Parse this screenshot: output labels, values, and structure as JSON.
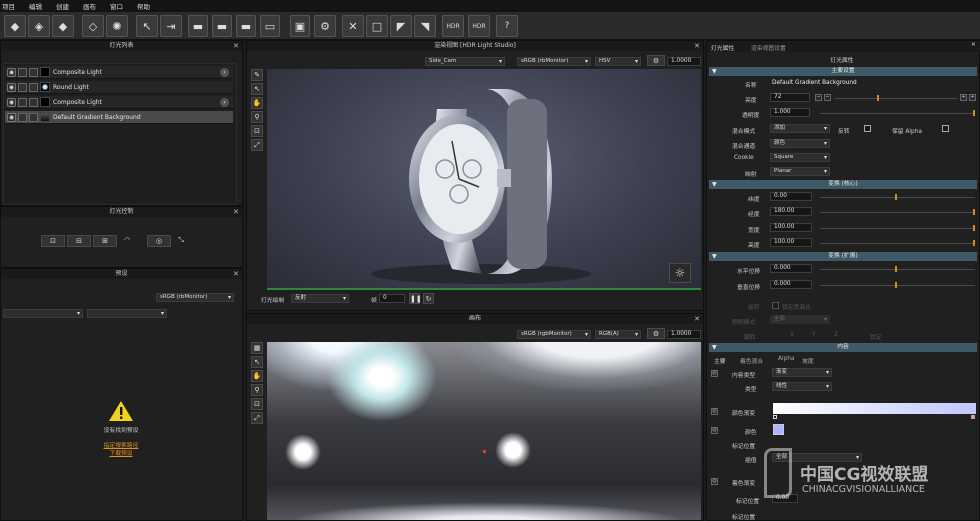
{
  "menu": [
    "项目",
    "编辑",
    "创建",
    "画布",
    "窗口",
    "帮助"
  ],
  "toolbar": {
    "hdr1": "HDR",
    "hdr2": "HDR",
    "help": "?"
  },
  "light_list": {
    "title": "灯光列表",
    "rows": [
      {
        "name": "Composite Light",
        "selected": false
      },
      {
        "name": "Round Light",
        "selected": false
      },
      {
        "name": "Composite Light",
        "selected": false
      },
      {
        "name": "Default Gradient Background",
        "selected": true
      }
    ]
  },
  "light_control": {
    "title": "灯光控制"
  },
  "presets": {
    "title": "预设",
    "color_space": "sRGB (rbMonitor)",
    "warning": "没有找到预设",
    "link1": "指定搜索路径",
    "link2": "下载预设"
  },
  "render_view": {
    "title": "渲染视图 [HDR Light Studio]",
    "camera": "Side_Cam",
    "color_space": "sRGB (rbMonitor)",
    "mode": "HSV",
    "value": "1.0000",
    "paint_label": "灯光绘制",
    "paint_mode": "反射",
    "frame_label": "帧",
    "frame_value": "0"
  },
  "canvas": {
    "title": "画布",
    "color_space": "sRGB (rgbMonitor)",
    "mode": "RGB(A)",
    "value": "1.0000"
  },
  "props": {
    "tab1": "灯光属性",
    "tab2": "渲染视图设置",
    "title": "灯光属性",
    "sec_main": "主要设置",
    "name_label": "名称",
    "name_value": "Default Gradient Background",
    "brightness_label": "亮度",
    "brightness_value": "72",
    "opacity_label": "透明度",
    "opacity_value": "1.000",
    "blend_label": "混合模式",
    "blend_value": "添加",
    "invert_label": "反转",
    "keep_alpha_label": "保留 Alpha",
    "blend_channel_label": "混合通道",
    "blend_channel_value": "颜色",
    "cookie_label": "Cookie",
    "cookie_value": "Square",
    "mapping_label": "映射",
    "mapping_value": "Planar",
    "sec_transform": "变换 (核心)",
    "lat_label": "纬度",
    "lat_value": "0.00",
    "lon_label": "经度",
    "lon_value": "180.00",
    "width_label": "宽度",
    "width_value": "100.00",
    "height_label": "高度",
    "height_value": "100.00",
    "sec_transform_ext": "变换 (扩展)",
    "hoff_label": "水平位移",
    "hoff_value": "0.000",
    "voff_label": "垂直位移",
    "voff_value": "0.000",
    "rotate_label": "旋转",
    "lock_aspect_label": "锁定宽高比",
    "light_mode_label": "照明模式",
    "light_mode_value": "全部",
    "flip_label": "翻转",
    "flip_x": "X",
    "flip_y": "Y",
    "flip_z": "Z",
    "lock_label": "锁定",
    "sec_content": "内容",
    "ctab_main": "主要",
    "ctab_blend": "着色混合",
    "ctab_alpha": "Alpha",
    "ctab_ramp": "坡度",
    "content_type_label": "内容类型",
    "content_type_value": "渐变",
    "type_label": "类型",
    "type_value": "线性",
    "gradient_label": "颜色渐变",
    "color_label": "颜色",
    "marker_label": "标记位置",
    "interp_label": "插值",
    "interp_value": "全部",
    "blend_grad_label": "着色渐变",
    "marker2_label": "标记位置",
    "marker2_value": "0.00",
    "marker3_label": "标记位置"
  },
  "watermark": {
    "cn": "中国CG视效联盟",
    "en": "CHINACGVISIONALLIANCE"
  },
  "colors": {
    "accent": "#d08a2a",
    "section": "#3f5a66",
    "green_bar": "#2a8a3a"
  }
}
